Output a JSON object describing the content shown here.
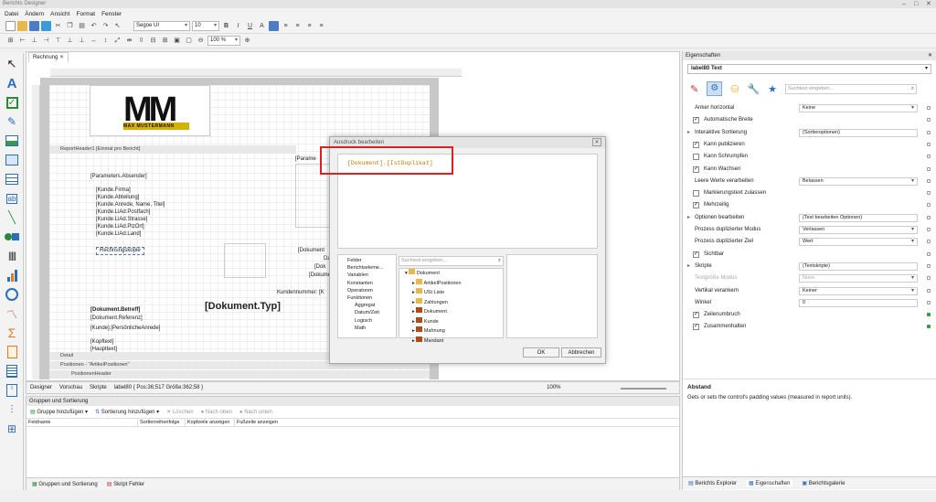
{
  "app": {
    "title": "Berichts Designer"
  },
  "menu": [
    "Datei",
    "Ändern",
    "Ansicht",
    "Format",
    "Fenster"
  ],
  "toolbar": {
    "font_name": "Segoe UI",
    "font_size": "10",
    "zoom": "100 %"
  },
  "document": {
    "tab": "Rechnung",
    "report_header": "ReportHeader1 [Einmal pro Bericht]",
    "fields": [
      "[Parameters.Absender]",
      "[Kunde.Firma]",
      "[Kunde.Abteilung]",
      "[Kunde.Anrede, Name, Titel]",
      "[Kunde.LiAd.Postfach]",
      "[Kunde.LiAd.Strasse]",
      "[Kunde.LiAd.PlzOrt]",
      "[Kunde.LiAd.Land]"
    ],
    "rechnungskopie": "Rechnungskopie",
    "parameters_short": "[Parame",
    "dokument_short": "[Dokument",
    "da_short": "Da",
    "dok_short": "[Dok",
    "dokumen_short": "[Dokumen",
    "kundennummer": "Kundennummer: [K",
    "betreff": "[Dokument.Betreff]",
    "referenz": "[Dokument.Referenz]",
    "anrede": "[Kunde].[PersönlicheAnrede]",
    "kopftext": "[Kopftext]",
    "hauptext": "[Haupttext]",
    "dok_typ": "[Dokument.Typ]",
    "detail_band": "Detail",
    "positionen_band": "Positionen - \"ArtikelPositionen\"",
    "positionen_header": "PositionenHeader",
    "logo_text": "MAX MUSTERMANN"
  },
  "statusbar": {
    "designer": "Designer",
    "preview": "Vorschau",
    "scripts": "Skripte",
    "info": "label80 { Pos:36;517 Größe:362;58 }",
    "zoom": "100%"
  },
  "dialog": {
    "title": "Ausdruck bearbeiten",
    "expression": "[Dokument].[IstDuplikat]",
    "search_placeholder": "Suchtext eingeben...",
    "ok": "OK",
    "cancel": "Abbrechen",
    "categories": [
      "Felder",
      "Berichtseleme...",
      "Variablen",
      "Konstanten",
      "Operatoren",
      "Funktionen",
      "Aggregat",
      "Datum/Zeit",
      "Logisch",
      "Math"
    ],
    "tree": [
      "Dokument",
      "ArtikelPositionen",
      "USt Liste",
      "Zahlungen",
      "Dokument",
      "Kunde",
      "Mahnung",
      "Mandant"
    ]
  },
  "properties": {
    "title": "Eigenschaften",
    "selected": "label80  Text",
    "search_placeholder": "Suchtext eingeben...",
    "rows": [
      {
        "label": "Anker horizontal",
        "value": "Keine",
        "type": "select"
      },
      {
        "label": "Automatische Breite",
        "type": "check",
        "checked": true
      },
      {
        "label": "Interaktive Sortierung",
        "value": "(Sortieroptionen)",
        "type": "text",
        "expand": true
      },
      {
        "label": "Kann publizieren",
        "type": "check",
        "checked": true
      },
      {
        "label": "Kann Schrumpfen",
        "type": "check",
        "checked": false
      },
      {
        "label": "Kann Wachsen",
        "type": "check",
        "checked": true
      },
      {
        "label": "Leere Werte verarbeiten",
        "value": "Belassen",
        "type": "select"
      },
      {
        "label": "Markierungstext zulassen",
        "type": "check",
        "checked": false
      },
      {
        "label": "Mehrzeilig",
        "type": "check",
        "checked": true
      },
      {
        "label": "Optionen bearbeiten",
        "value": "(Text bearbeiten Optionen)",
        "type": "text",
        "expand": true
      },
      {
        "label": "Prozess duplizierter Modus",
        "value": "Verlassen",
        "type": "select"
      },
      {
        "label": "Prozess duplizierter Ziel",
        "value": "Wert",
        "type": "select"
      },
      {
        "label": "Sichtbar",
        "type": "check",
        "checked": true
      },
      {
        "label": "Skripte",
        "value": "(Textskripte)",
        "type": "text",
        "expand": true
      },
      {
        "label": "Textgröße Modus",
        "value": "None",
        "type": "select",
        "disabled": true
      },
      {
        "label": "Vertikal verankern",
        "value": "Keiner",
        "type": "select"
      },
      {
        "label": "Winkel",
        "value": "0",
        "type": "text"
      },
      {
        "label": "Zeilenumbruch",
        "type": "check",
        "checked": true
      },
      {
        "label": "Zusammenhalten",
        "type": "check",
        "checked": true
      }
    ],
    "desc_title": "Abstand",
    "desc_text": "Gets or sets the control's padding values (measured in report units).",
    "bottom_tabs": [
      "Berichts Explorer",
      "Eigenschaften",
      "Berichtsgalerie"
    ]
  },
  "groups": {
    "title": "Gruppen und Sortierung",
    "add_group": "Gruppe hinzufügen",
    "add_sort": "Sortierung hinzufügen",
    "delete": "Löschen",
    "up": "Nach oben",
    "down": "Nach unten",
    "columns": [
      "Feldname",
      "Sortierreihenfolge",
      "Kopfzeile anzeigen",
      "Fußzeile anzeigen"
    ],
    "tabs": [
      "Gruppen und Sortierung",
      "Skript Fehler"
    ]
  }
}
